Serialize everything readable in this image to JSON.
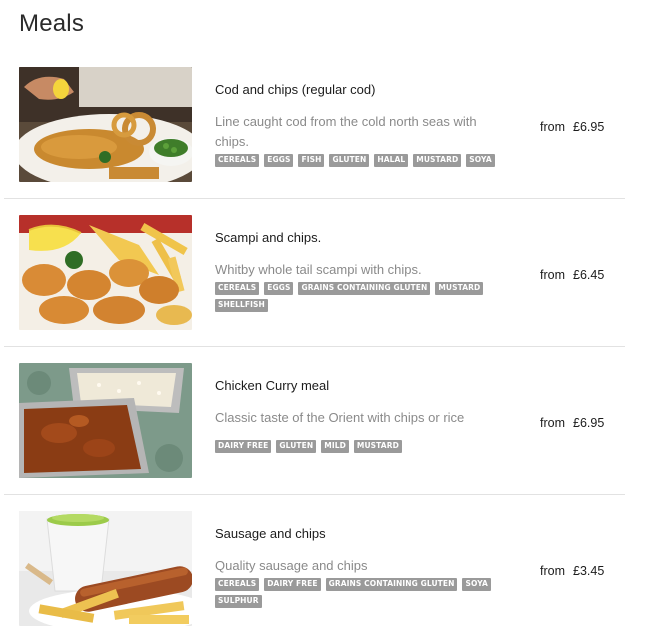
{
  "page": {
    "title": "Meals"
  },
  "colors": {
    "tag_bg": "#9a9a9a",
    "divider": "#e2e2e2",
    "desc_text": "#8a8a8a"
  },
  "items": [
    {
      "name": "Cod and chips (regular cod)",
      "description": "Line caught cod from the cold north seas with chips.",
      "tags": [
        "CEREALS",
        "EGGS",
        "FISH",
        "GLUTEN",
        "HALAL",
        "MUSTARD",
        "SOYA"
      ],
      "price_prefix": "from",
      "price": "£6.95",
      "image_icon": "cod-and-chips-photo"
    },
    {
      "name": "Scampi and chips.",
      "description": "Whitby whole tail scampi with chips.",
      "tags": [
        "CEREALS",
        "EGGS",
        "GRAINS CONTAINING GLUTEN",
        "MUSTARD",
        "SHELLFISH"
      ],
      "price_prefix": "from",
      "price": "£6.45",
      "image_icon": "scampi-photo"
    },
    {
      "name": "Chicken Curry meal",
      "description": "Classic taste of the Orient with chips or rice",
      "tags": [
        "DAIRY FREE",
        "GLUTEN",
        "MILD",
        "MUSTARD"
      ],
      "price_prefix": "from",
      "price": "£6.95",
      "image_icon": "chicken-curry-photo"
    },
    {
      "name": "Sausage and chips",
      "description": "Quality sausage and chips",
      "tags": [
        "CEREALS",
        "DAIRY FREE",
        "GRAINS CONTAINING GLUTEN",
        "SOYA",
        "SULPHUR"
      ],
      "price_prefix": "from",
      "price": "£3.45",
      "image_icon": "sausage-photo"
    }
  ]
}
